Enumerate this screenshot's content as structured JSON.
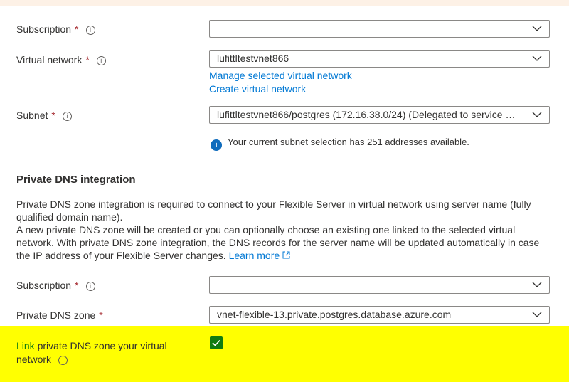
{
  "required_marker": "*",
  "info_glyph": "i",
  "network": {
    "subscription_label": "Subscription",
    "subscription_value": "",
    "vnet_label": "Virtual network",
    "vnet_value": "lufittltestvnet866",
    "manage_vnet_link": "Manage selected virtual network",
    "create_vnet_link": "Create virtual network",
    "subnet_label": "Subnet",
    "subnet_value": "lufittltestvnet866/postgres (172.16.38.0/24) (Delegated to service Mi...",
    "subnet_info": "Your current subnet selection has 251 addresses available."
  },
  "dns": {
    "heading": "Private DNS integration",
    "description_1": "Private DNS zone integration is required to connect to your Flexible Server in virtual network using server name (fully qualified domain name).",
    "description_2": "A new private DNS zone will be created or you can optionally choose an existing one linked to the selected virtual network. With private DNS zone integration, the DNS records for the server name will be updated automatically in case the IP address of your Flexible Server changes.",
    "learn_more": "Learn more",
    "subscription_label": "Subscription",
    "subscription_value": "",
    "zone_label": "Private DNS zone",
    "zone_value": "vnet-flexible-13.private.postgres.database.azure.com",
    "link_label_prefix": "Link",
    "link_label_rest": "private DNS zone your virtual network",
    "link_checked": true
  },
  "colors": {
    "link": "#0078d4",
    "highlight": "#ffff01",
    "checkbox": "#107c10",
    "required": "#a4262c"
  }
}
